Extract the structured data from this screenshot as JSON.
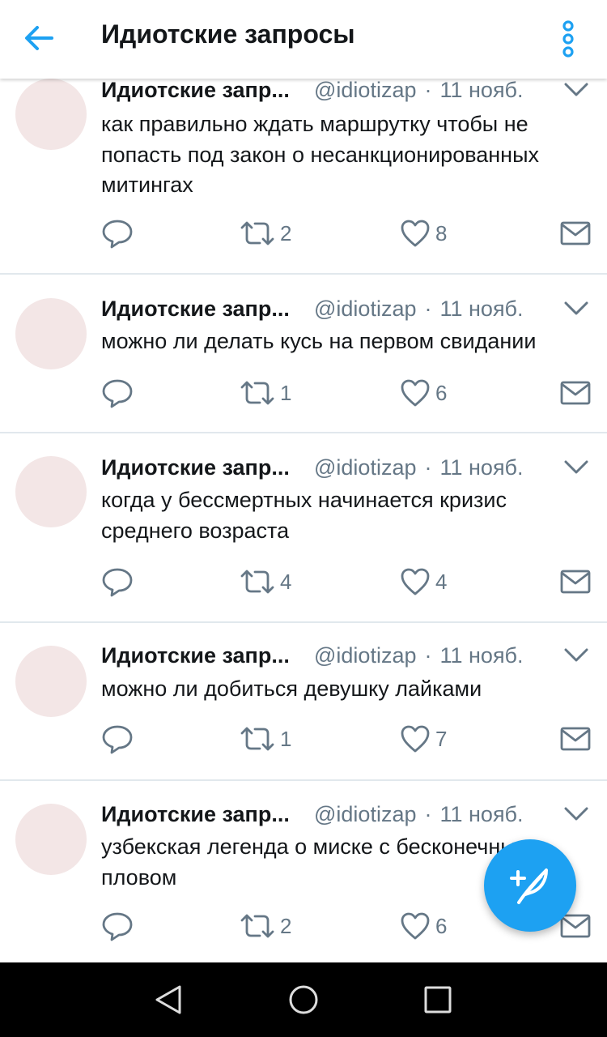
{
  "header": {
    "title": "Идиотские запросы",
    "back_icon": "arrow-left-icon",
    "more_icon": "more-vertical-icon",
    "accent": "#1da1f2"
  },
  "tweets": [
    {
      "name": "Идиотские запр...",
      "handle": "@idiotizap",
      "separator": "·",
      "date": "11 нояб.",
      "text": "как правильно ждать маршрутку чтобы не попасть под закон о несанкционированных митингах",
      "retweets": "2",
      "likes": "8"
    },
    {
      "name": "Идиотские запр...",
      "handle": "@idiotizap",
      "separator": "·",
      "date": "11 нояб.",
      "text": "можно ли делать кусь на первом свидании",
      "retweets": "1",
      "likes": "6"
    },
    {
      "name": "Идиотские запр...",
      "handle": "@idiotizap",
      "separator": "·",
      "date": "11 нояб.",
      "text": "когда у бессмертных начинается кризис среднего возраста",
      "retweets": "4",
      "likes": "4"
    },
    {
      "name": "Идиотские запр...",
      "handle": "@idiotizap",
      "separator": "·",
      "date": "11 нояб.",
      "text": "можно ли добиться девушку лайками",
      "retweets": "1",
      "likes": "7"
    },
    {
      "name": "Идиотские запр...",
      "handle": "@idiotizap",
      "separator": "·",
      "date": "11 нояб.",
      "text": "узбекская легенда о миске с бесконечным пловом",
      "retweets": "2",
      "likes": "6"
    }
  ],
  "compose_icon": "compose-tweet-icon",
  "colors": {
    "text": "#14171a",
    "muted": "#657786",
    "divider": "#e1e8ed",
    "fab": "#1da1f2",
    "navbar": "#000000"
  }
}
